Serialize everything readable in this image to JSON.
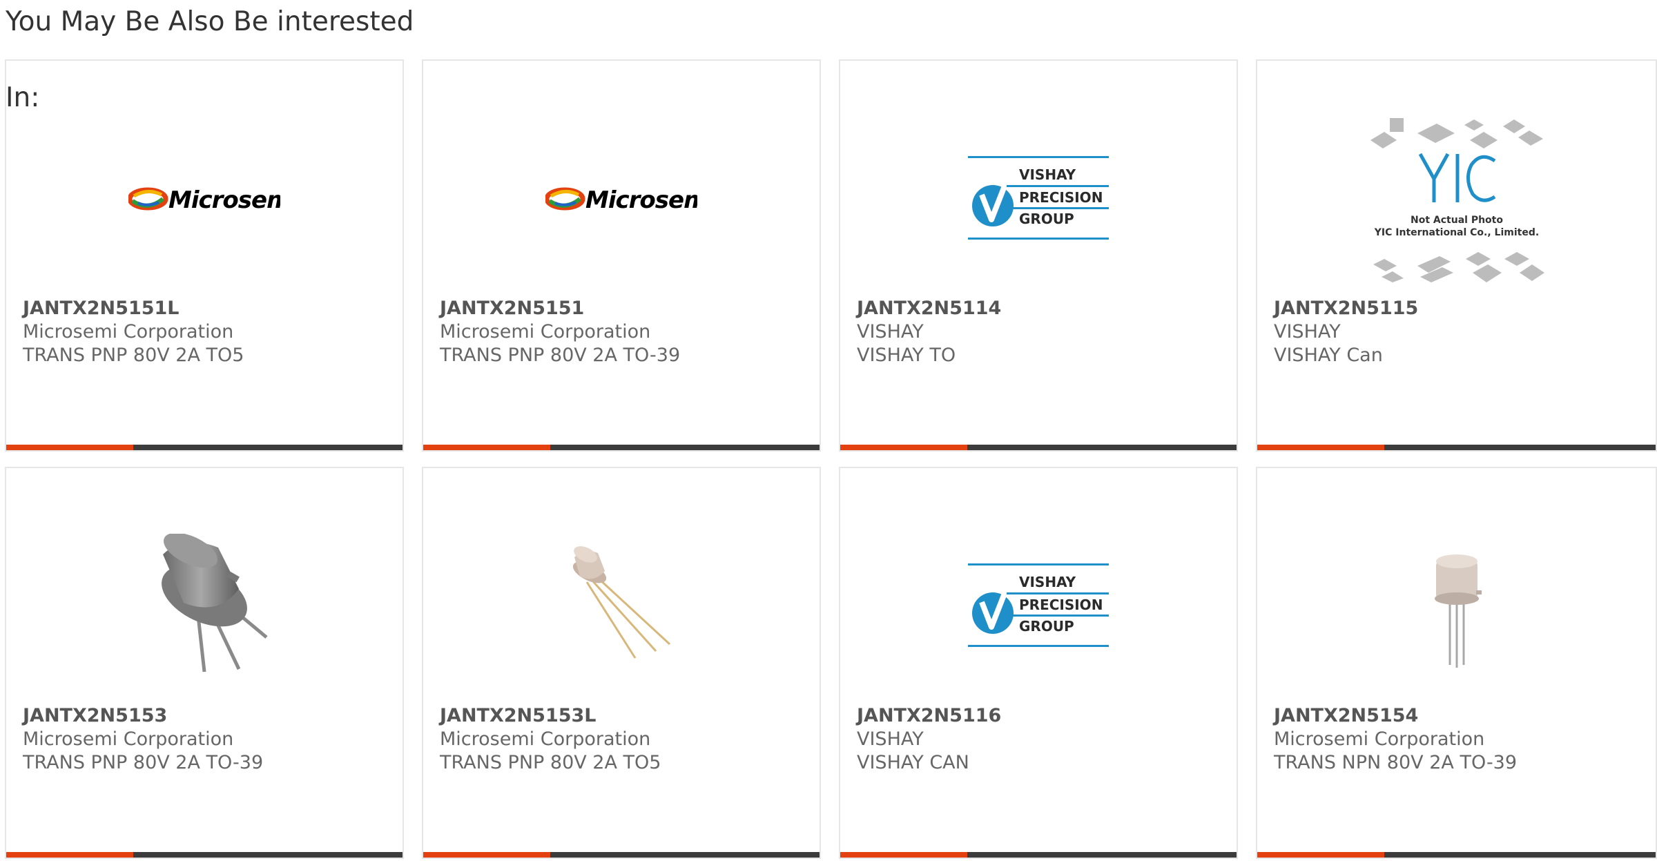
{
  "section": {
    "title_line1": "You May Be Also Be interested",
    "title_line2": "In:"
  },
  "logos": {
    "microsemi": "Microsemi",
    "vishay_l1": "VISHAY",
    "vishay_l2": "PRECISION",
    "vishay_l3": "GROUP",
    "yic_l1": "Not Actual Photo",
    "yic_l2": "YIC International Co., Limited."
  },
  "colors": {
    "accent": "#e3410f",
    "bar": "#3c3c3c",
    "border": "#e6e6e6",
    "vishay_blue": "#1f8fc9"
  },
  "products": [
    {
      "part": "JANTX2N5151L",
      "manufacturer": "Microsemi Corporation",
      "description": "TRANS PNP 80V 2A TO5",
      "image": "microsemi-logo"
    },
    {
      "part": "JANTX2N5151",
      "manufacturer": "Microsemi Corporation",
      "description": "TRANS PNP 80V 2A TO-39",
      "image": "microsemi-logo"
    },
    {
      "part": "JANTX2N5114",
      "manufacturer": "VISHAY",
      "description": "VISHAY TO",
      "image": "vishay-logo"
    },
    {
      "part": "JANTX2N5115",
      "manufacturer": "VISHAY",
      "description": "VISHAY Can",
      "image": "yic-placeholder"
    },
    {
      "part": "JANTX2N5153",
      "manufacturer": "Microsemi Corporation",
      "description": "TRANS PNP 80V 2A TO-39",
      "image": "to39-transistor-photo"
    },
    {
      "part": "JANTX2N5153L",
      "manufacturer": "Microsemi Corporation",
      "description": "TRANS PNP 80V 2A TO5",
      "image": "to5-transistor-photo"
    },
    {
      "part": "JANTX2N5116",
      "manufacturer": "VISHAY",
      "description": "VISHAY CAN",
      "image": "vishay-logo"
    },
    {
      "part": "JANTX2N5154",
      "manufacturer": "Microsemi Corporation",
      "description": "TRANS NPN 80V 2A TO-39",
      "image": "to39-small-transistor-photo"
    }
  ]
}
